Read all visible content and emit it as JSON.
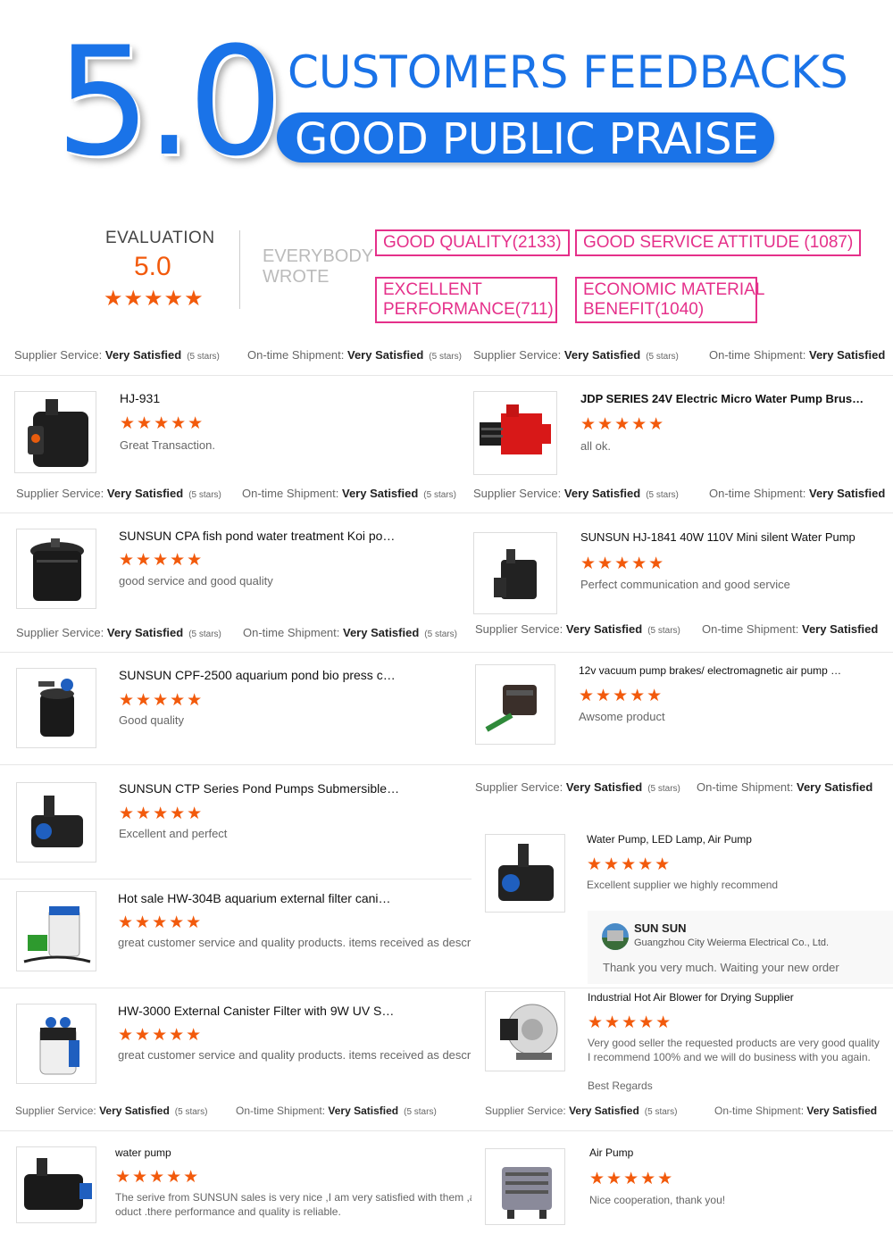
{
  "header": {
    "score": "5.0",
    "headline": "CUSTOMERS FEEDBACKS",
    "praise": "GOOD PUBLIC PRAISE"
  },
  "evaluation": {
    "label": "EVALUATION",
    "score": "5.0",
    "stars": "★★★★★",
    "everybody_wrote": "EVERYBODY WROTE"
  },
  "tags": {
    "good_quality": "GOOD QUALITY(2133)",
    "good_service": "GOOD SERVICE ATTITUDE (1087)",
    "excellent_line1": "EXCELLENT",
    "excellent_line2": "PERFORMANCE(711)",
    "economic_line1": "ECONOMIC MATERIAL",
    "economic_line2": "BENEFIT(1040)"
  },
  "meta_labels": {
    "supplier": "Supplier Service:",
    "shipment": "On-time Shipment:",
    "value": "Very Satisfied",
    "stars": "(5 stars)"
  },
  "reviews": [
    {
      "title": "HJ-931",
      "stars": "★★★★★",
      "comment": "Great Transaction."
    },
    {
      "title": "JDP SERIES 24V Electric Micro Water Pump Brus…",
      "stars": "★★★★★",
      "comment": "all ok."
    },
    {
      "title": "SUNSUN CPA fish pond water treatment Koi po…",
      "stars": "★★★★★",
      "comment": "good service and good quality"
    },
    {
      "title": "SUNSUN HJ-1841 40W 110V Mini silent Water Pump",
      "stars": "★★★★★",
      "comment": "Perfect communication and good service"
    },
    {
      "title": "SUNSUN CPF-2500 aquarium pond bio press c…",
      "stars": "★★★★★",
      "comment": "Good quality"
    },
    {
      "title": "12v vacuum pump brakes/ electromagnetic air pump …",
      "stars": "★★★★★",
      "comment": "Awsome product"
    },
    {
      "title": "SUNSUN CTP Series Pond Pumps Submersible…",
      "stars": "★★★★★",
      "comment": "Excellent and perfect"
    },
    {
      "title": "Water Pump, LED Lamp, Air Pump",
      "stars": "★★★★★",
      "comment": "Excellent supplier we highly recommend"
    },
    {
      "title": "Hot sale HW-304B aquarium external filter cani…",
      "stars": "★★★★★",
      "comment": "great customer service and quality products. items received as described"
    },
    {
      "title": "HW-3000 External Canister Filter with 9W UV S…",
      "stars": "★★★★★",
      "comment": "great customer service and quality products. items received as described"
    },
    {
      "title": "Industrial Hot Air Blower for Drying Supplier",
      "stars": "★★★★★",
      "comment": "Very good seller the requested products are very good quality",
      "comment2": "I recommend 100% and we will do business with you again.",
      "comment3": "Best Regards"
    },
    {
      "title": "water pump",
      "stars": "★★★★★",
      "comment": "The serive from SUNSUN sales is very nice ,I am very satisfied with them ,and",
      "comment2": "oduct .there performance and quality is reliable."
    },
    {
      "title": "Air Pump",
      "stars": "★★★★★",
      "comment": "Nice cooperation, thank you!"
    }
  ],
  "reply": {
    "name": "SUN SUN",
    "company": "Guangzhou City Weierma Electrical Co., Ltd.",
    "text": "Thank you very much. Waiting your new order"
  },
  "colors": {
    "brand_blue": "#1a73e8",
    "star_orange": "#f25a0c",
    "tag_pink": "#e5308a"
  },
  "icons": {
    "star": "star-icon",
    "avatar": "supplier-avatar"
  }
}
